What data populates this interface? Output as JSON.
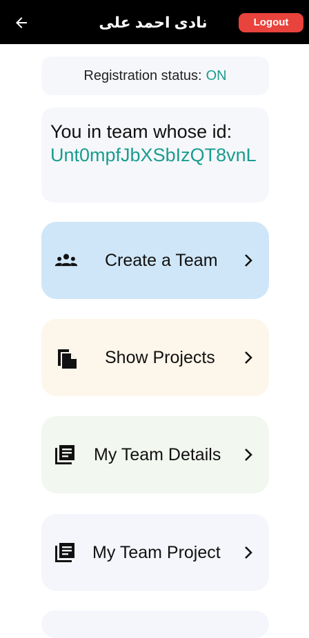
{
  "appbar": {
    "title": "نادی احمد علی",
    "logout_label": "Logout",
    "back_icon": "arrow-back-icon"
  },
  "status": {
    "label": "Registration status:",
    "value": "ON"
  },
  "team": {
    "label": "You in team whose id:",
    "id": "Unt0mpfJbXSbIzQT8vnL"
  },
  "menu": [
    {
      "label": "Create a Team",
      "icon": "people-icon",
      "color": "#cfe6f8"
    },
    {
      "label": "Show Projects",
      "icon": "copy-file-icon",
      "color": "#fdf6ea"
    },
    {
      "label": "My Team Details",
      "icon": "library-books-icon",
      "color": "#f2f7ef"
    },
    {
      "label": "My Team Project",
      "icon": "library-books-icon",
      "color": "#f5f6fb"
    }
  ],
  "colors": {
    "accent_teal": "#1a9c8e",
    "logout_red": "#e8433c",
    "appbar_bg": "#000000"
  }
}
